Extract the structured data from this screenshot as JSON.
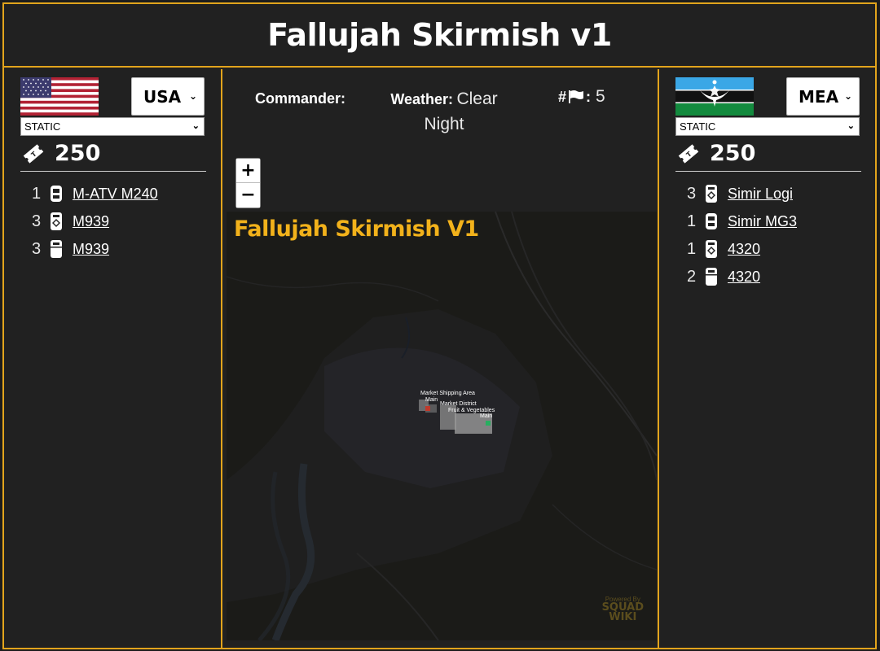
{
  "page_title": "Fallujah Skirmish v1",
  "left_team": {
    "faction": "USA",
    "mode": "STATIC",
    "tickets": "250",
    "vehicles": [
      {
        "count": "1",
        "name": "M-ATV M240",
        "icon": "wheeled-vehicle-icon"
      },
      {
        "count": "3",
        "name": "M939",
        "icon": "logistics-truck-icon"
      },
      {
        "count": "3",
        "name": "M939",
        "icon": "transport-truck-icon"
      }
    ]
  },
  "right_team": {
    "faction": "MEA",
    "mode": "STATIC",
    "tickets": "250",
    "vehicles": [
      {
        "count": "3",
        "name": "Simir Logi",
        "icon": "logistics-truck-icon"
      },
      {
        "count": "1",
        "name": "Simir MG3",
        "icon": "wheeled-vehicle-icon"
      },
      {
        "count": "1",
        "name": "4320",
        "icon": "logistics-truck-icon"
      },
      {
        "count": "2",
        "name": "4320",
        "icon": "transport-truck-icon"
      }
    ]
  },
  "info": {
    "commander_label": "Commander:",
    "commander_value": "",
    "weather_label": "Weather:",
    "weather_value": "Clear Night",
    "flags_prefix": "#",
    "flags_colon": ":",
    "flags_value": "5"
  },
  "map": {
    "title": "Fallujah Skirmish V1",
    "zoom_in": "+",
    "zoom_out": "−",
    "poi_labels": [
      "Market Shipping Area",
      "Main",
      "Market District",
      "Fruit & Vegetables",
      "Main"
    ],
    "watermark_small": "Powered By",
    "watermark_big": "SQUAD",
    "watermark_big2": "WIKI"
  },
  "colors": {
    "accent": "#e2a41c",
    "map_title": "#f2b21b",
    "background": "#212121"
  }
}
